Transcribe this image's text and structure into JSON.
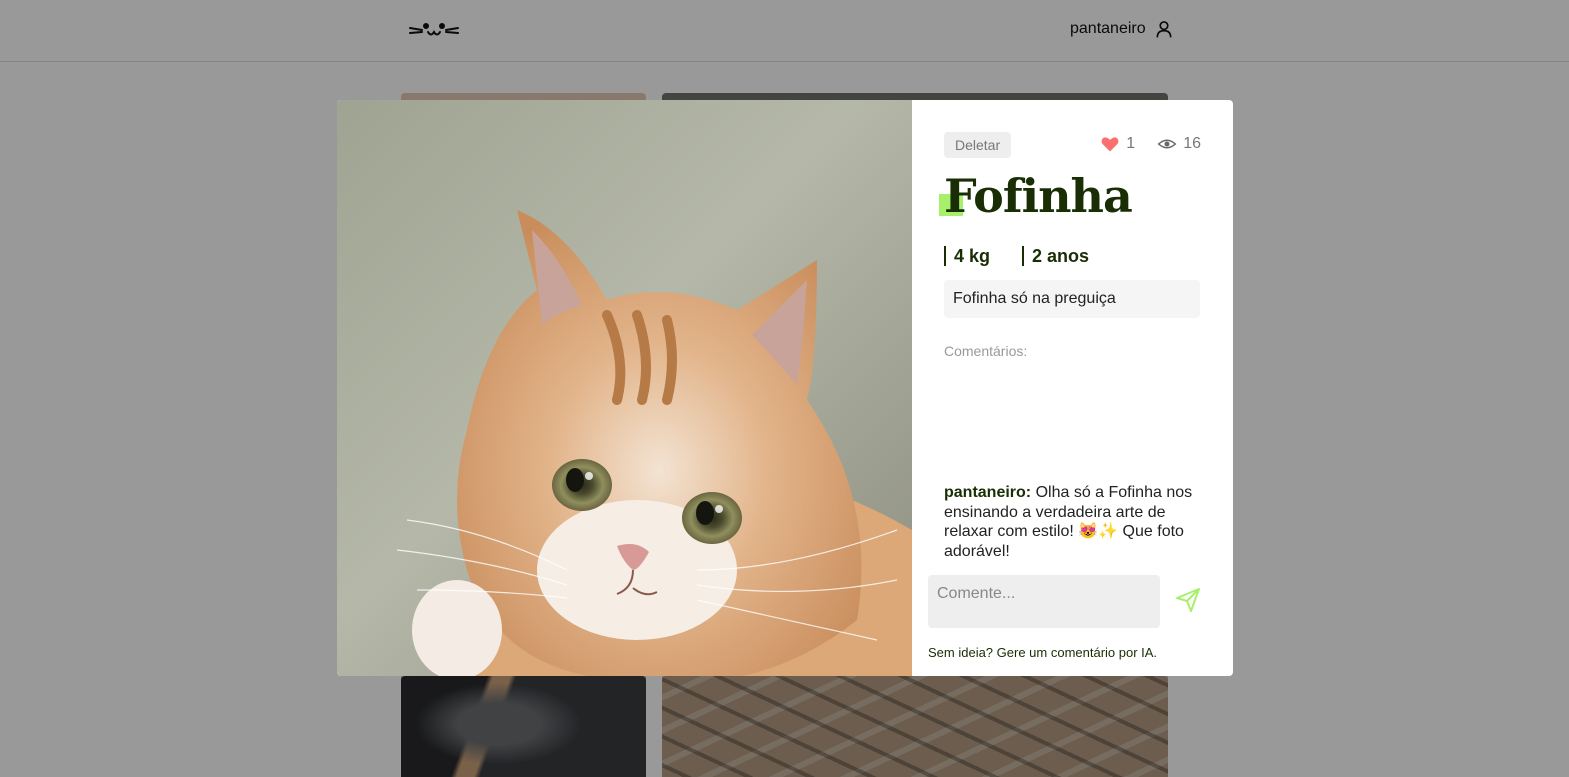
{
  "header": {
    "logo_text": "=•ᴥ•=",
    "username": "pantaneiro",
    "logo_icon": "cat-face-icon",
    "user_icon": "user-icon"
  },
  "modal": {
    "delete_label": "Deletar",
    "likes": "1",
    "views": "16",
    "title": "Fofinha",
    "weight": "4 kg",
    "age": "2 anos",
    "description": "Fofinha só na preguiça",
    "comments_label": "Comentários:",
    "comments": [
      {
        "author": "pantaneiro:",
        "text": " Olha só a Fofinha nos ensinando a verdadeira arte de relaxar com estilo! 😻✨ Que foto adorável!"
      }
    ],
    "comment_placeholder": "Comente...",
    "ai_hint": "Sem ideia? Gere um comentário por IA."
  },
  "colors": {
    "accent": "#a6f06a",
    "heart": "#fb6f6f",
    "title": "#1a2e05"
  }
}
